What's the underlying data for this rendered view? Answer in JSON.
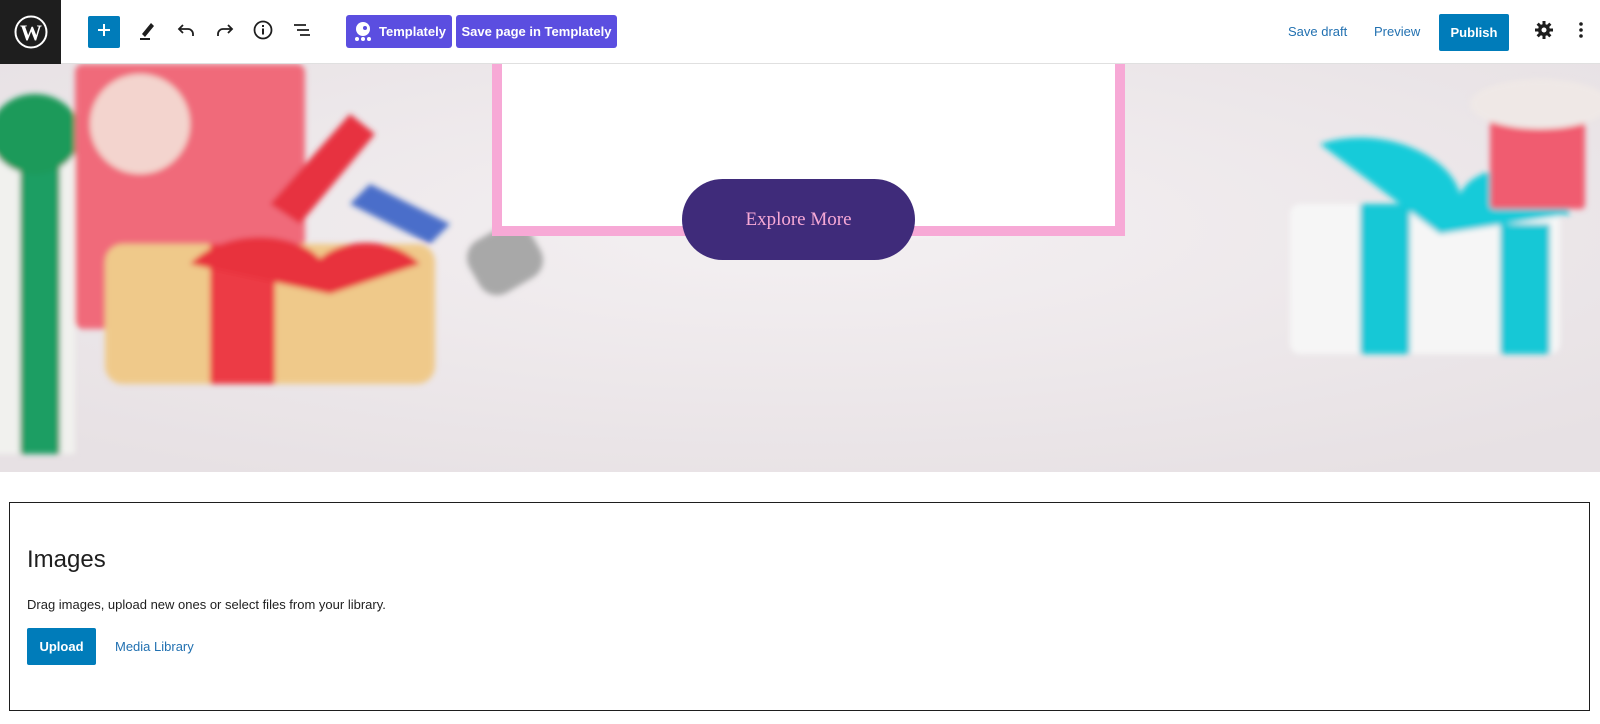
{
  "toolbar": {
    "templately_label": "Templately",
    "save_templately_label": "Save page in Templately",
    "save_draft_label": "Save draft",
    "preview_label": "Preview",
    "publish_label": "Publish",
    "icons": [
      "wordpress-logo-icon",
      "plus-icon",
      "pencil-icon",
      "undo-icon",
      "redo-icon",
      "info-icon",
      "list-view-icon",
      "templately-icon",
      "gear-icon",
      "more-vertical-icon"
    ]
  },
  "hero": {
    "button_label": "Explore More",
    "colors": {
      "frame": "#f7a9d6",
      "button_bg": "#3f2b7a",
      "button_text": "#f7a9d6"
    }
  },
  "images_block": {
    "title": "Images",
    "description": "Drag images, upload new ones or select files from your library.",
    "upload_label": "Upload",
    "media_library_label": "Media Library"
  },
  "colors": {
    "accent": "#007cba",
    "templately": "#5b4ee0",
    "link": "#2271b1"
  }
}
